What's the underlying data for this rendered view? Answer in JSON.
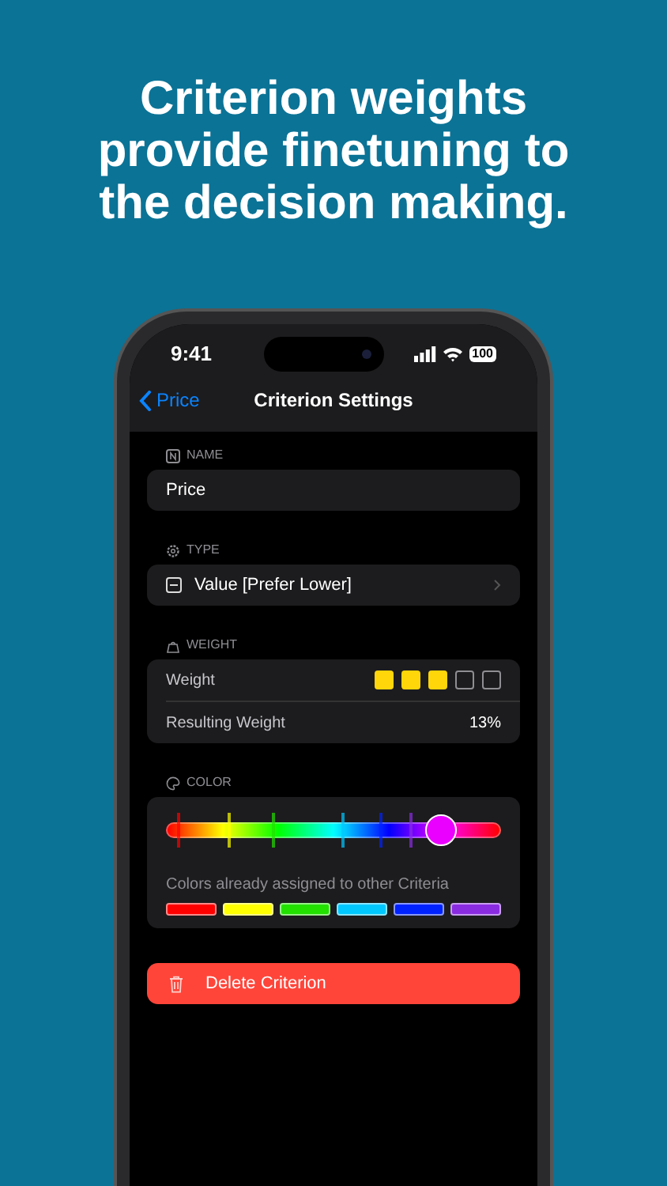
{
  "headline": "Criterion weights provide finetuning to the decision making.",
  "status_bar": {
    "time": "9:41",
    "battery": "100"
  },
  "nav": {
    "back": "Price",
    "title": "Criterion Settings"
  },
  "name_section": {
    "header": "NAME",
    "value": "Price"
  },
  "type_section": {
    "header": "TYPE",
    "value": "Value [Prefer Lower]"
  },
  "weight_section": {
    "header": "WEIGHT",
    "weight_label": "Weight",
    "stars": 3,
    "result_label": "Resulting Weight",
    "result_value": "13%"
  },
  "color_section": {
    "header": "COLOR",
    "level": 0.82,
    "assigned_label": "Colors already assigned to other Criteria",
    "assigned": [
      {
        "color": "#ff0000",
        "level": 0.04
      },
      {
        "color": "#ffff00",
        "level": 0.19
      },
      {
        "color": "#22e000",
        "level": 0.32
      },
      {
        "color": "#00c8ff",
        "level": 0.53
      },
      {
        "color": "#0022ff",
        "level": 0.64
      },
      {
        "color": "#8a2be2",
        "level": 0.73
      }
    ]
  },
  "delete_button": "Delete Criterion"
}
